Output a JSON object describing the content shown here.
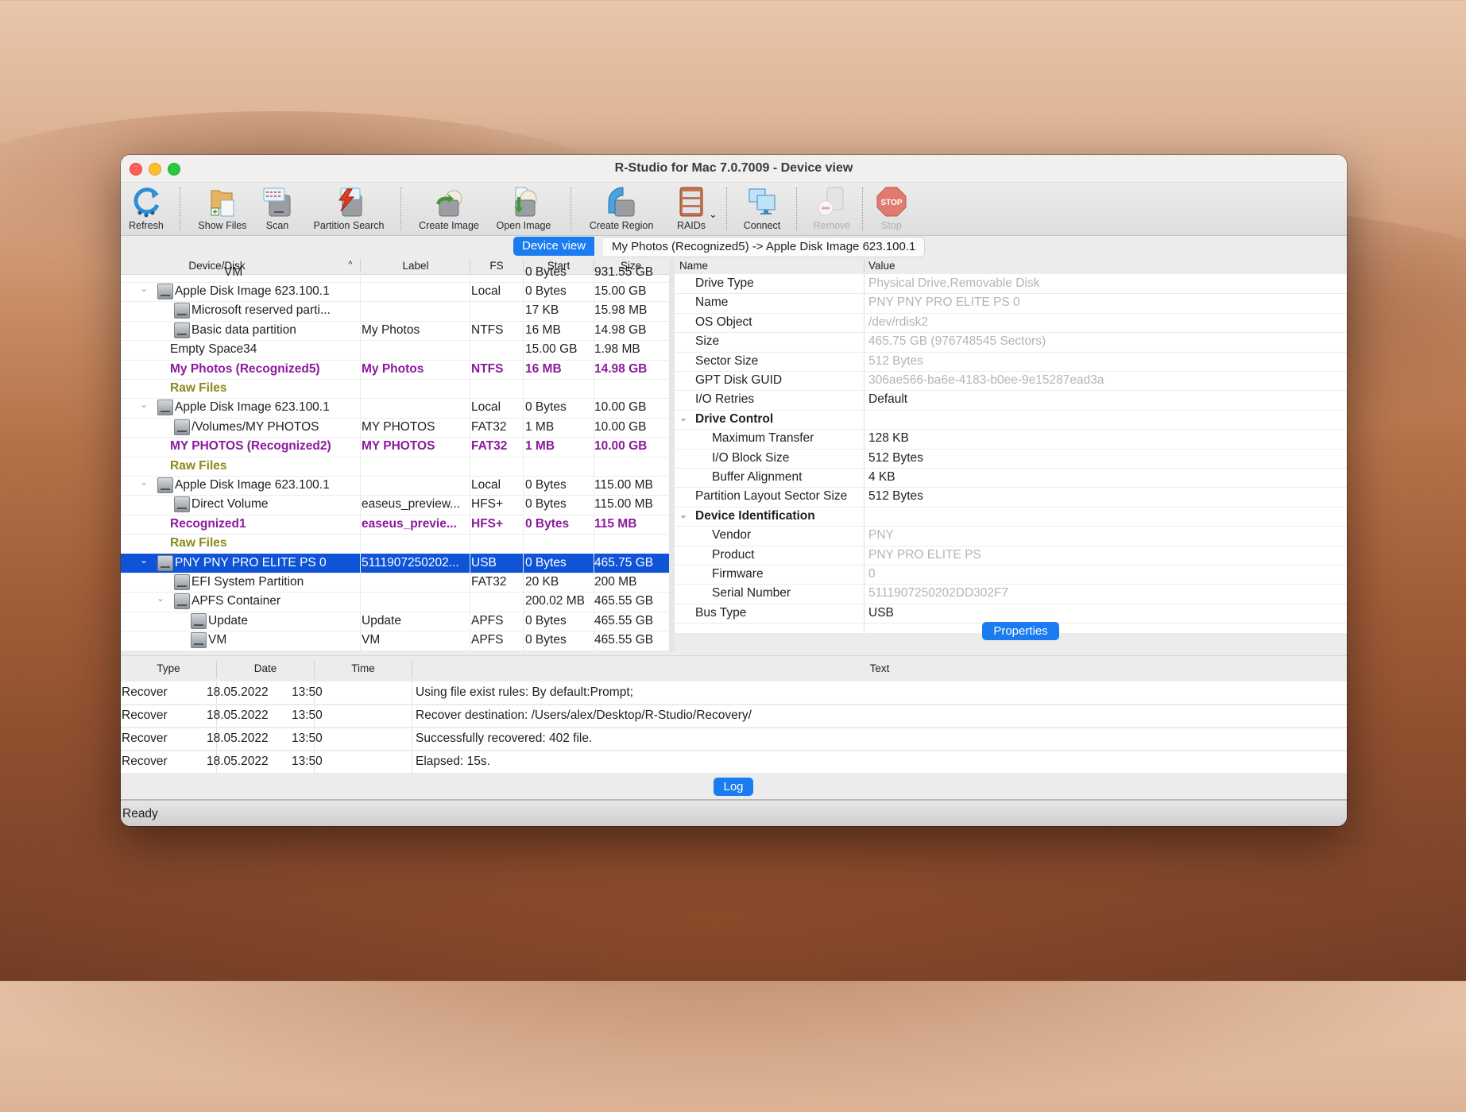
{
  "window": {
    "title": "R-Studio for Mac 7.0.7009 - Device view"
  },
  "toolbar": {
    "items": [
      {
        "id": "refresh",
        "label": "Refresh",
        "icon": "refresh-icon",
        "enabled": true
      },
      {
        "id": "show-files",
        "label": "Show Files",
        "icon": "show-files-icon",
        "enabled": true
      },
      {
        "id": "scan",
        "label": "Scan",
        "icon": "scan-icon",
        "enabled": true
      },
      {
        "id": "partition-search",
        "label": "Partition Search",
        "icon": "partition-search-icon",
        "enabled": true
      },
      {
        "id": "create-image",
        "label": "Create Image",
        "icon": "create-image-icon",
        "enabled": true
      },
      {
        "id": "open-image",
        "label": "Open Image",
        "icon": "open-image-icon",
        "enabled": true
      },
      {
        "id": "create-region",
        "label": "Create Region",
        "icon": "create-region-icon",
        "enabled": true
      },
      {
        "id": "raids",
        "label": "RAIDs",
        "icon": "raid-icon",
        "enabled": true
      },
      {
        "id": "connect",
        "label": "Connect",
        "icon": "connect-icon",
        "enabled": true
      },
      {
        "id": "remove",
        "label": "Remove",
        "icon": "remove-icon",
        "enabled": false
      },
      {
        "id": "stop",
        "label": "Stop",
        "icon": "stop-icon",
        "enabled": false
      }
    ]
  },
  "tabs": [
    {
      "label": "Device view",
      "active": true
    },
    {
      "label": "My Photos (Recognized5) -> Apple Disk Image 623.100.1",
      "active": false
    }
  ],
  "device_table": {
    "columns": [
      "Device/Disk",
      "Label",
      "FS",
      "Start",
      "Size"
    ],
    "sort_indicator": "^",
    "partial_top_row": {
      "device": "VM",
      "start": "0 Bytes",
      "size": "931.55 GB"
    },
    "rows": [
      {
        "device": "Apple Disk Image 623.100.1",
        "label": "",
        "fs": "Local",
        "start": "0 Bytes",
        "size": "15.00 GB",
        "level": 0,
        "expander": true,
        "icon": true,
        "kind": "normal"
      },
      {
        "device": "Microsoft reserved parti...",
        "label": "",
        "fs": "",
        "start": "17 KB",
        "size": "15.98 MB",
        "level": 1,
        "expander": false,
        "icon": true,
        "kind": "normal"
      },
      {
        "device": "Basic data partition",
        "label": "My Photos",
        "fs": "NTFS",
        "start": "16 MB",
        "size": "14.98 GB",
        "level": 1,
        "expander": false,
        "icon": true,
        "kind": "normal"
      },
      {
        "device": "Empty Space34",
        "label": "",
        "fs": "",
        "start": "15.00 GB",
        "size": "1.98 MB",
        "level": 1,
        "expander": false,
        "icon": false,
        "kind": "normal"
      },
      {
        "device": "My Photos (Recognized5)",
        "label": "My Photos",
        "fs": "NTFS",
        "start": "16 MB",
        "size": "14.98 GB",
        "level": 1,
        "expander": false,
        "icon": false,
        "kind": "recognized"
      },
      {
        "device": "Raw Files",
        "label": "",
        "fs": "",
        "start": "",
        "size": "",
        "level": 1,
        "expander": false,
        "icon": false,
        "kind": "raw"
      },
      {
        "device": "Apple Disk Image 623.100.1",
        "label": "",
        "fs": "Local",
        "start": "0 Bytes",
        "size": "10.00 GB",
        "level": 0,
        "expander": true,
        "icon": true,
        "kind": "normal"
      },
      {
        "device": "/Volumes/MY PHOTOS",
        "label": "MY PHOTOS",
        "fs": "FAT32",
        "start": "1 MB",
        "size": "10.00 GB",
        "level": 1,
        "expander": false,
        "icon": true,
        "kind": "normal"
      },
      {
        "device": "MY PHOTOS (Recognized2)",
        "label": "MY PHOTOS",
        "fs": "FAT32",
        "start": "1 MB",
        "size": "10.00 GB",
        "level": 1,
        "expander": false,
        "icon": false,
        "kind": "recognized"
      },
      {
        "device": "Raw Files",
        "label": "",
        "fs": "",
        "start": "",
        "size": "",
        "level": 1,
        "expander": false,
        "icon": false,
        "kind": "raw"
      },
      {
        "device": "Apple Disk Image 623.100.1",
        "label": "",
        "fs": "Local",
        "start": "0 Bytes",
        "size": "115.00 MB",
        "level": 0,
        "expander": true,
        "icon": true,
        "kind": "normal"
      },
      {
        "device": "Direct Volume",
        "label": "easeus_preview...",
        "fs": "HFS+",
        "start": "0 Bytes",
        "size": "115.00 MB",
        "level": 1,
        "expander": false,
        "icon": true,
        "kind": "normal"
      },
      {
        "device": "Recognized1",
        "label": "easeus_previe...",
        "fs": "HFS+",
        "start": "0 Bytes",
        "size": "115 MB",
        "level": 1,
        "expander": false,
        "icon": false,
        "kind": "recognized"
      },
      {
        "device": "Raw Files",
        "label": "",
        "fs": "",
        "start": "",
        "size": "",
        "level": 1,
        "expander": false,
        "icon": false,
        "kind": "raw"
      },
      {
        "device": "PNY PNY PRO ELITE PS 0",
        "label": "5111907250202...",
        "fs": "USB",
        "start": "0 Bytes",
        "size": "465.75 GB",
        "level": 0,
        "expander": true,
        "icon": true,
        "kind": "selected"
      },
      {
        "device": "EFI System Partition",
        "label": "",
        "fs": "FAT32",
        "start": "20 KB",
        "size": "200 MB",
        "level": 1,
        "expander": false,
        "icon": true,
        "kind": "normal"
      },
      {
        "device": "APFS Container",
        "label": "",
        "fs": "",
        "start": "200.02 MB",
        "size": "465.55 GB",
        "level": 1,
        "expander": true,
        "icon": true,
        "kind": "normal"
      },
      {
        "device": "Update",
        "label": "Update",
        "fs": "APFS",
        "start": "0 Bytes",
        "size": "465.55 GB",
        "level": 2,
        "expander": false,
        "icon": true,
        "kind": "normal"
      },
      {
        "device": "VM",
        "label": "VM",
        "fs": "APFS",
        "start": "0 Bytes",
        "size": "465.55 GB",
        "level": 2,
        "expander": false,
        "icon": true,
        "kind": "normal"
      }
    ]
  },
  "properties": {
    "columns": [
      "Name",
      "Value"
    ],
    "rows": [
      {
        "name": "Drive Type",
        "value": "Physical Drive,Removable Disk",
        "level": 0,
        "muted": true,
        "group": false
      },
      {
        "name": "Name",
        "value": "PNY PNY PRO ELITE PS 0",
        "level": 0,
        "muted": true,
        "group": false
      },
      {
        "name": "OS Object",
        "value": "/dev/rdisk2",
        "level": 0,
        "muted": true,
        "group": false
      },
      {
        "name": "Size",
        "value": "465.75 GB (976748545 Sectors)",
        "level": 0,
        "muted": true,
        "group": false
      },
      {
        "name": "Sector Size",
        "value": "512 Bytes",
        "level": 0,
        "muted": true,
        "group": false
      },
      {
        "name": "GPT Disk GUID",
        "value": "306ae566-ba6e-4183-b0ee-9e15287ead3a",
        "level": 0,
        "muted": true,
        "group": false
      },
      {
        "name": "I/O Retries",
        "value": "Default",
        "level": 0,
        "muted": false,
        "group": false
      },
      {
        "name": "Drive Control",
        "value": "",
        "level": 0,
        "muted": false,
        "group": true
      },
      {
        "name": "Maximum Transfer",
        "value": "128 KB",
        "level": 1,
        "muted": false,
        "group": false
      },
      {
        "name": "I/O Block Size",
        "value": "512 Bytes",
        "level": 1,
        "muted": false,
        "group": false
      },
      {
        "name": "Buffer Alignment",
        "value": "4 KB",
        "level": 1,
        "muted": false,
        "group": false
      },
      {
        "name": "Partition Layout Sector Size",
        "value": "512 Bytes",
        "level": 0,
        "muted": false,
        "group": false
      },
      {
        "name": "Device Identification",
        "value": "",
        "level": 0,
        "muted": false,
        "group": true
      },
      {
        "name": "Vendor",
        "value": "PNY",
        "level": 1,
        "muted": true,
        "group": false
      },
      {
        "name": "Product",
        "value": "PNY PRO ELITE PS",
        "level": 1,
        "muted": true,
        "group": false
      },
      {
        "name": "Firmware",
        "value": "0",
        "level": 1,
        "muted": true,
        "group": false
      },
      {
        "name": "Serial Number",
        "value": "5111907250202DD302F7",
        "level": 1,
        "muted": true,
        "group": false
      },
      {
        "name": "Bus Type",
        "value": "USB",
        "level": 0,
        "muted": false,
        "group": false
      }
    ],
    "button_label": "Properties"
  },
  "log": {
    "columns": [
      "Type",
      "Date",
      "Time",
      "Text"
    ],
    "rows": [
      {
        "type": "Recover",
        "date": "18.05.2022",
        "time": "13:50",
        "text": "Using file exist rules: By default:Prompt;"
      },
      {
        "type": "Recover",
        "date": "18.05.2022",
        "time": "13:50",
        "text": "Recover destination: /Users/alex/Desktop/R-Studio/Recovery/"
      },
      {
        "type": "Recover",
        "date": "18.05.2022",
        "time": "13:50",
        "text": "Successfully recovered: 402 file."
      },
      {
        "type": "Recover",
        "date": "18.05.2022",
        "time": "13:50",
        "text": "Elapsed: 15s."
      }
    ],
    "button_label": "Log"
  },
  "status": {
    "text": "Ready"
  },
  "colors": {
    "accent": "#1a7cf0",
    "selection": "#0f54d6",
    "recognized": "#8b1a9c",
    "raw_files": "#8a8a1a",
    "muted_value": "#b4b4b4"
  }
}
